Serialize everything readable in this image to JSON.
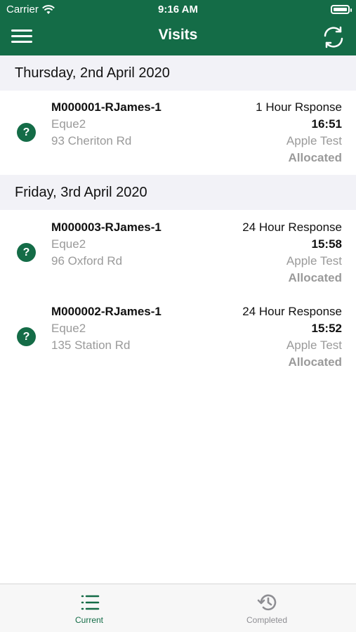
{
  "status_bar": {
    "carrier": "Carrier",
    "time": "9:16 AM"
  },
  "nav": {
    "title": "Visits",
    "menu_icon": "hamburger-menu-icon",
    "refresh_icon": "refresh-icon"
  },
  "colors": {
    "brand_green": "#146c47",
    "section_bg": "#f2f2f7",
    "secondary_text": "#9a9a9a"
  },
  "sections": [
    {
      "date": "Thursday, 2nd April 2020",
      "visits": [
        {
          "icon": "?",
          "reference": "M000001-RJames-1",
          "company": "Eque2",
          "address": "93 Cheriton Rd",
          "priority": "1 Hour Rsponse",
          "time": "16:51",
          "client": "Apple Test",
          "status": "Allocated"
        }
      ]
    },
    {
      "date": "Friday, 3rd April 2020",
      "visits": [
        {
          "icon": "?",
          "reference": "M000003-RJames-1",
          "company": "Eque2",
          "address": "96 Oxford Rd",
          "priority": "24 Hour Response",
          "time": "15:58",
          "client": "Apple Test",
          "status": "Allocated"
        },
        {
          "icon": "?",
          "reference": "M000002-RJames-1",
          "company": "Eque2",
          "address": "135 Station Rd",
          "priority": "24 Hour Response",
          "time": "15:52",
          "client": "Apple Test",
          "status": "Allocated"
        }
      ]
    }
  ],
  "tabs": [
    {
      "label": "Current",
      "icon": "list-icon",
      "active": true
    },
    {
      "label": "Completed",
      "icon": "history-icon",
      "active": false
    }
  ]
}
